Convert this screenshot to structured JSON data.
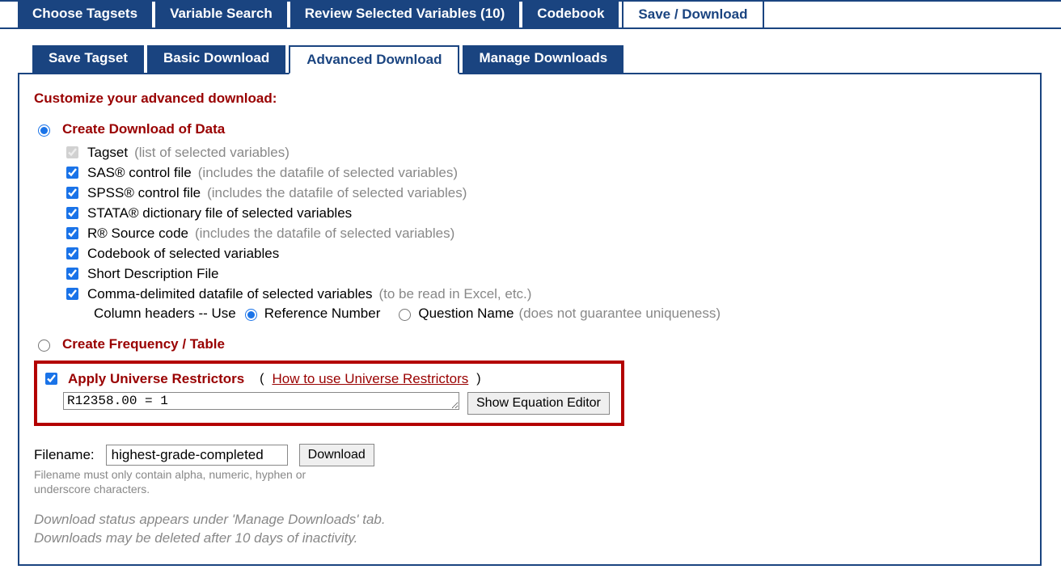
{
  "top_tabs": {
    "choose": "Choose Tagsets",
    "search": "Variable Search",
    "review": "Review Selected Variables (10)",
    "codebook": "Codebook",
    "save": "Save / Download"
  },
  "sub_tabs": {
    "save_tagset": "Save Tagset",
    "basic": "Basic Download",
    "advanced": "Advanced Download",
    "manage": "Manage Downloads"
  },
  "title": "Customize your advanced download:",
  "section1": {
    "label": "Create Download of Data",
    "items": {
      "tagset": "Tagset",
      "tagset_hint": "(list of selected variables)",
      "sas": "SAS® control file",
      "sas_hint": "(includes the datafile of selected variables)",
      "spss": "SPSS® control file",
      "spss_hint": "(includes the datafile of selected variables)",
      "stata": "STATA® dictionary file of selected variables",
      "r": "R® Source code",
      "r_hint": "(includes the datafile of selected variables)",
      "codebook": "Codebook of selected variables",
      "shortdesc": "Short Description File",
      "csv": "Comma-delimited datafile of selected variables",
      "csv_hint": "(to be read in Excel, etc.)",
      "colheaders_prefix": "Column headers -- Use",
      "colheaders_ref": "Reference Number",
      "colheaders_q": "Question Name",
      "colheaders_hint": "(does not guarantee uniqueness)"
    }
  },
  "section2": {
    "label": "Create Frequency / Table"
  },
  "restrictor": {
    "label": "Apply Universe Restrictors",
    "link": "How to use Universe Restrictors",
    "value": "R12358.00 = 1",
    "button": "Show Equation Editor"
  },
  "filename": {
    "label": "Filename:",
    "value": "highest-grade-completed",
    "button": "Download",
    "hint": "Filename must only contain alpha, numeric, hyphen or underscore characters."
  },
  "footer": {
    "line1": "Download status appears under 'Manage Downloads' tab.",
    "line2": "Downloads may be deleted after 10 days of inactivity."
  }
}
